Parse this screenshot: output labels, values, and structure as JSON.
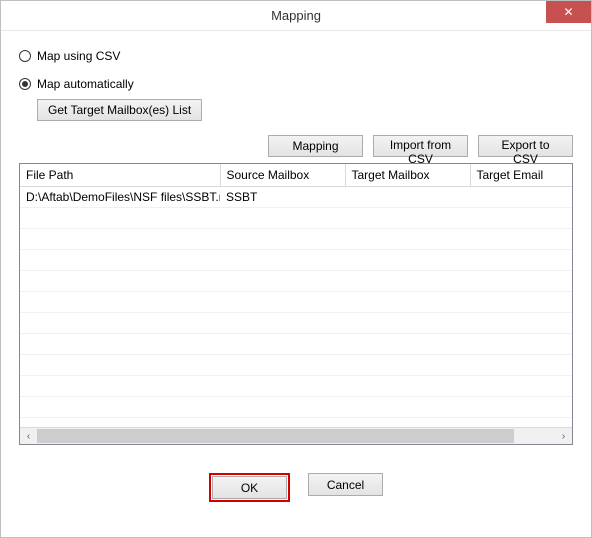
{
  "window": {
    "title": "Mapping",
    "close_glyph": "✕"
  },
  "options": {
    "map_csv_label": "Map using CSV",
    "map_auto_label": "Map automatically",
    "selected": "auto",
    "get_target_label": "Get Target Mailbox(es) List"
  },
  "toolbar": {
    "mapping": "Mapping",
    "import_csv": "Import from CSV",
    "export_csv": "Export to CSV"
  },
  "table": {
    "headers": [
      "File Path",
      "Source Mailbox",
      "Target Mailbox",
      "Target Email"
    ],
    "rows": [
      {
        "file_path": "D:\\Aftab\\DemoFiles\\NSF files\\SSBT.nsf",
        "source_mailbox": "SSBT",
        "target_mailbox": "",
        "target_email": ""
      }
    ]
  },
  "scroll": {
    "left_glyph": "‹",
    "right_glyph": "›"
  },
  "footer": {
    "ok": "OK",
    "cancel": "Cancel"
  }
}
